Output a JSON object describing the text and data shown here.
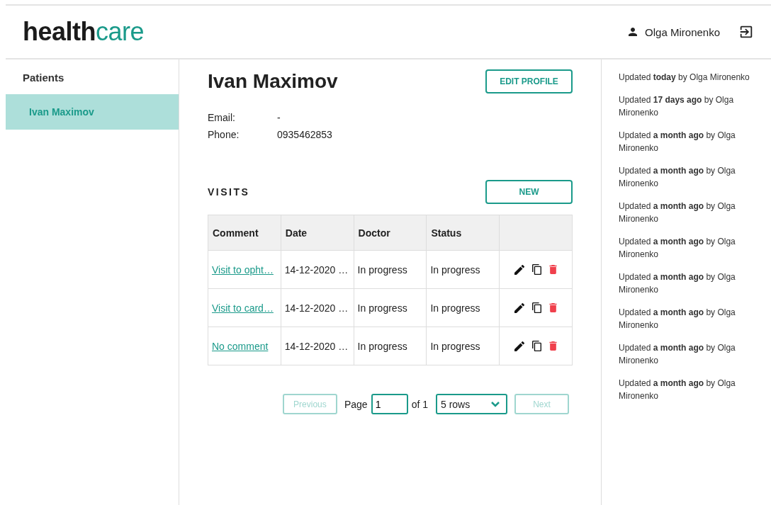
{
  "logo": {
    "dark": "health",
    "accent": "care"
  },
  "user": {
    "name": "Olga Mironenko"
  },
  "sidebar": {
    "heading": "Patients",
    "items": [
      {
        "label": "Ivan Maximov",
        "selected": true
      }
    ]
  },
  "patient": {
    "name": "Ivan Maximov",
    "edit_button": "EDIT PROFILE",
    "fields": [
      {
        "label": "Email:",
        "value": "-"
      },
      {
        "label": "Phone:",
        "value": "0935462853"
      }
    ]
  },
  "visits": {
    "title": "VISITS",
    "new_button": "NEW",
    "columns": [
      "Comment",
      "Date",
      "Doctor",
      "Status"
    ],
    "rows": [
      {
        "comment": "Visit to opht…",
        "date": "14-12-2020 …",
        "doctor": "In progress",
        "status": "In progress"
      },
      {
        "comment": "Visit to card…",
        "date": "14-12-2020 …",
        "doctor": "In progress",
        "status": "In progress"
      },
      {
        "comment": "No comment",
        "date": "14-12-2020 …",
        "doctor": "In progress",
        "status": "In progress"
      }
    ]
  },
  "pagination": {
    "previous": {
      "label": "Previous",
      "disabled": true
    },
    "page_label": "Page",
    "page": "1",
    "of": "of 1",
    "rows": "5 rows",
    "next": {
      "label": "Next",
      "disabled": true
    }
  },
  "activity": [
    "Updated **today** by Olga Mironenko",
    "Updated **17 days ago** by Olga Mironenko",
    "Updated **a month ago** by Olga Mironenko",
    "Updated **a month ago** by Olga Mironenko",
    "Updated **a month ago** by Olga Mironenko",
    "Updated **a month ago** by Olga Mironenko",
    "Updated **a month ago** by Olga Mironenko",
    "Updated **a month ago** by Olga Mironenko",
    "Updated **a month ago** by Olga Mironenko",
    "Updated **a month ago** by Olga Mironenko"
  ]
}
